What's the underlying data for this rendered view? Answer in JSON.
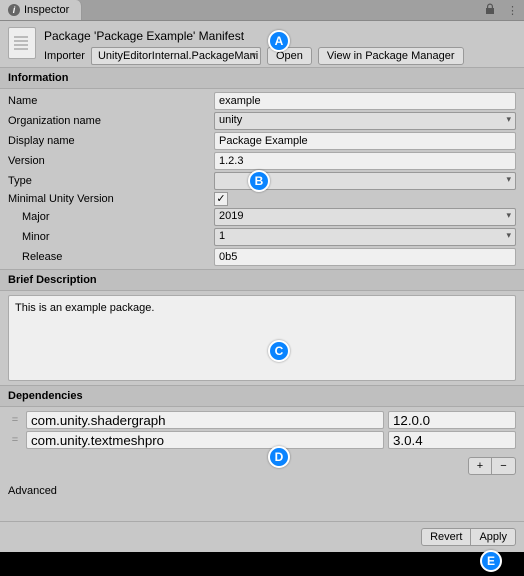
{
  "tab": {
    "label": "Inspector"
  },
  "header": {
    "title": "Package 'Package Example' Manifest",
    "importer_label": "Importer",
    "importer_value": "UnityEditorInternal.PackageMani",
    "open_label": "Open",
    "view_label": "View in Package Manager"
  },
  "sections": {
    "information": "Information",
    "brief_description": "Brief Description",
    "dependencies": "Dependencies",
    "advanced": "Advanced"
  },
  "info": {
    "name_label": "Name",
    "name_value": "example",
    "org_label": "Organization name",
    "org_value": "unity",
    "display_label": "Display name",
    "display_value": "Package Example",
    "version_label": "Version",
    "version_value": "1.2.3",
    "type_label": "Type",
    "type_value": "",
    "minver_label": "Minimal Unity Version",
    "major_label": "Major",
    "major_value": "2019",
    "minor_label": "Minor",
    "minor_value": "1",
    "release_label": "Release",
    "release_value": "0b5"
  },
  "description": "This is an example package.",
  "deps": [
    {
      "name": "com.unity.shadergraph",
      "version": "12.0.0"
    },
    {
      "name": "com.unity.textmeshpro",
      "version": "3.0.4"
    }
  ],
  "dep_buttons": {
    "add": "+",
    "remove": "−"
  },
  "footer": {
    "revert": "Revert",
    "apply": "Apply"
  },
  "callouts": {
    "a": "A",
    "b": "B",
    "c": "C",
    "d": "D",
    "e": "E"
  }
}
